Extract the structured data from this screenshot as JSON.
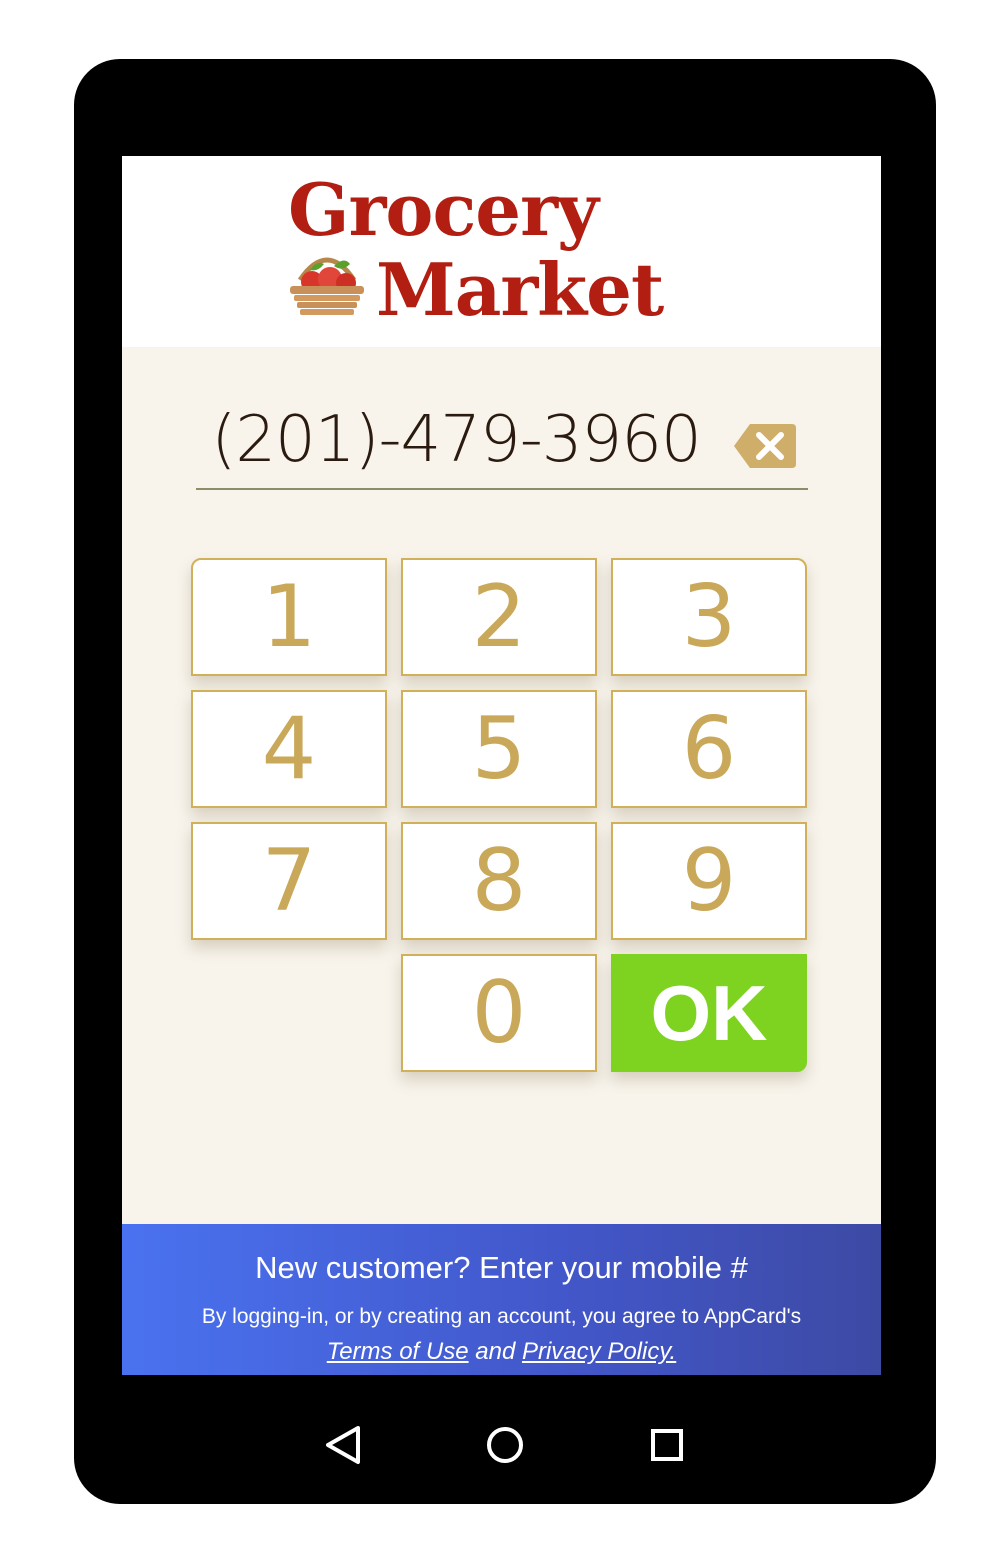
{
  "brand": {
    "line1": "Grocery",
    "line2": "Market",
    "color": "#b21e11"
  },
  "phone": {
    "value": "(201)-479-3960",
    "clear_icon": "backspace-icon"
  },
  "keypad": {
    "keys": [
      "1",
      "2",
      "3",
      "4",
      "5",
      "6",
      "7",
      "8",
      "9",
      "0"
    ],
    "ok_label": "OK",
    "ok_color": "#7ed321",
    "key_color": "#c9a85a"
  },
  "footer": {
    "title": "New customer? Enter your mobile #",
    "legal": "By logging-in, or by creating an account, you agree to AppCard's",
    "terms_label": "Terms of Use",
    "and_text": "and",
    "privacy_label": "Privacy Policy."
  },
  "nav": {
    "back_icon": "back-triangle-icon",
    "home_icon": "home-circle-icon",
    "recent_icon": "recent-apps-square-icon"
  }
}
